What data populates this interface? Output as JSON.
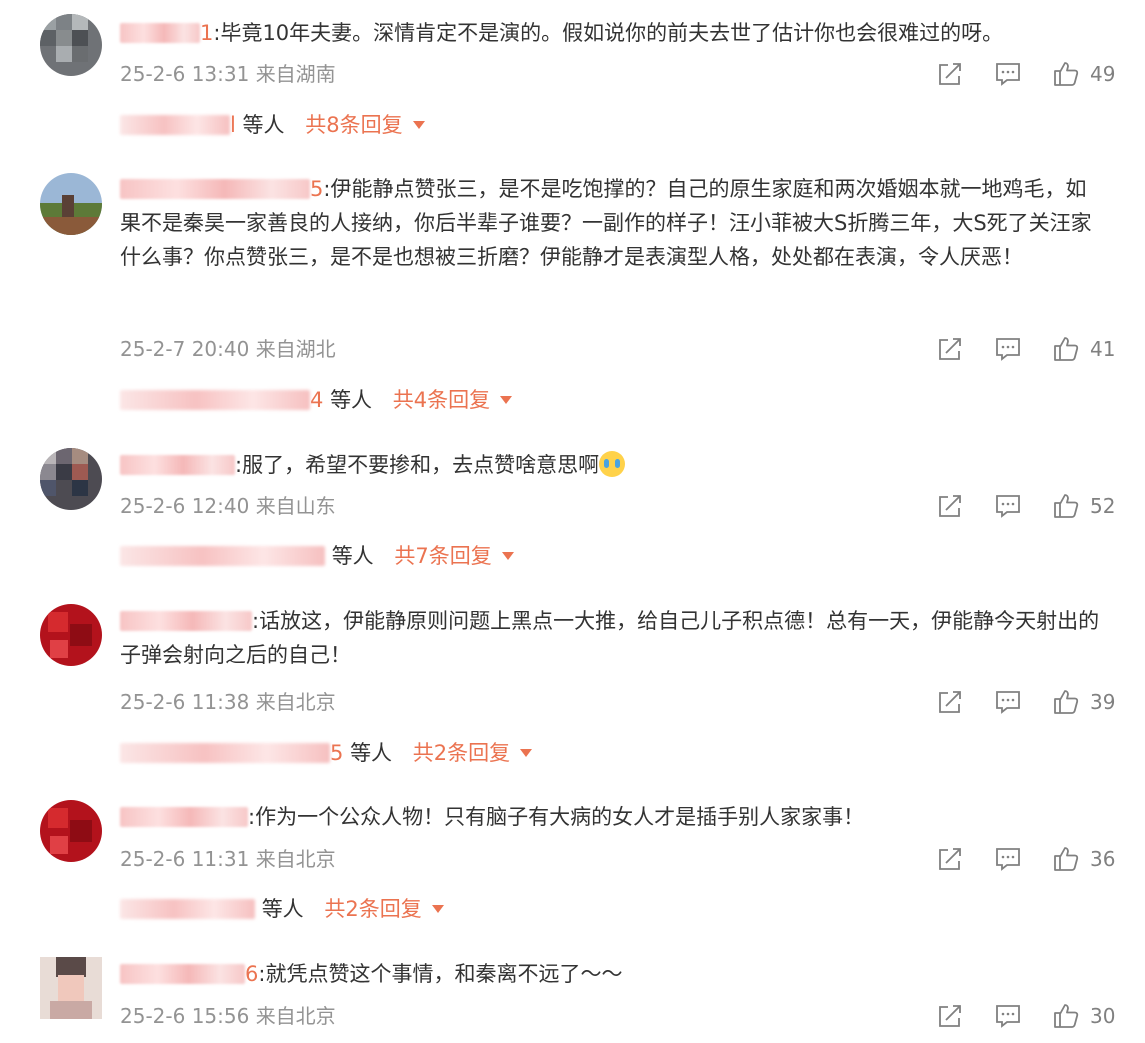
{
  "comments": [
    {
      "name_tail": "1",
      "text": ":毕竟10年夫妻。深情肯定不是演的。假如说你的前夫去世了估计你也会很难过的呀。",
      "time": "25-2-6 13:31",
      "location": "来自湖南",
      "likes": "49",
      "replies_who_tail": "l",
      "replies_suffix": "等人",
      "replies_count": "共8条回复"
    },
    {
      "name_tail": "5",
      "text": ":伊能静点赞张三，是不是吃饱撑的？自己的原生家庭和两次婚姻本就一地鸡毛，如果不是秦昊一家善良的人接纳，你后半辈子谁要？一副作的样子！汪小菲被大S折腾三年，大S死了关汪家什么事？你点赞张三，是不是也想被三折磨？伊能静才是表演型人格，处处都在表演，令人厌恶！",
      "time": "25-2-7 20:40",
      "location": "来自湖北",
      "likes": "41",
      "replies_who_tail": "4",
      "replies_suffix": "等人",
      "replies_count": "共4条回复"
    },
    {
      "name_tail": "",
      "text": ":服了，希望不要掺和，去点赞啥意思啊",
      "time": "25-2-6 12:40",
      "location": "来自山东",
      "likes": "52",
      "replies_who_tail": "",
      "replies_suffix": "等人",
      "replies_count": "共7条回复"
    },
    {
      "name_tail": "",
      "text": ":话放这，伊能静原则问题上黑点一大推，给自己儿子积点德！总有一天，伊能静今天射出的子弹会射向之后的自己！",
      "time": "25-2-6 11:38",
      "location": "来自北京",
      "likes": "39",
      "replies_who_tail": "5",
      "replies_suffix": "等人",
      "replies_count": "共2条回复"
    },
    {
      "name_tail": "",
      "text": ":作为一个公众人物！只有脑子有大病的女人才是插手别人家家事！",
      "time": "25-2-6 11:31",
      "location": "来自北京",
      "likes": "36",
      "replies_who_tail": "",
      "replies_suffix": "等人",
      "replies_count": "共2条回复"
    },
    {
      "name_tail": "6",
      "text": ":就凭点赞这个事情，和秦离不远了～～",
      "time": "25-2-6 15:56",
      "location": "来自北京",
      "likes": "30"
    }
  ],
  "icons": {
    "share": "share-icon",
    "comment": "comment-icon",
    "like": "thumbs-up-icon",
    "expand": "caret-down-icon",
    "emoji": "crying-emoji-icon"
  },
  "colors": {
    "accent": "#eb7350",
    "meta": "#939393",
    "text": "#333333"
  }
}
